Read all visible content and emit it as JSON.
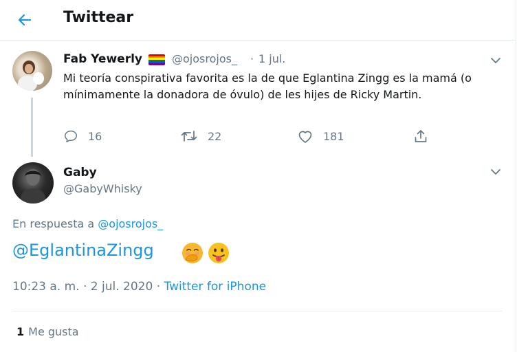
{
  "header": {
    "title": "Twittear"
  },
  "parent_tweet": {
    "name": "Fab Yewerly",
    "handle": "@ojosrojos_",
    "separator": "·",
    "date": "1 jul.",
    "text": "Mi teoría conspirativa favorita es la de que Eglantina Zingg es la mamá (o mínimamente la donadora de óvulo) de les hijes de Ricky Martin.",
    "replies": "16",
    "retweets": "22",
    "likes": "181"
  },
  "main_tweet": {
    "name": "Gaby",
    "handle": "@GabyWhisky",
    "reply_prefix": "En respuesta a",
    "reply_handle": "@ojosrojos_",
    "mention": "@EglantinaZingg",
    "emojis": [
      "face-with-hand-over-mouth",
      "face-with-tongue"
    ],
    "time_date": "10:23 a. m. · 2 jul. 2020 ·",
    "source": "Twitter for iPhone",
    "like_count": "1",
    "like_label": "Me gusta"
  },
  "colors": {
    "accent": "#1b95e0",
    "secondary_text": "#657786",
    "border": "#e6ecf0",
    "thread_line": "#ccd6dd",
    "flag": [
      "#e40303",
      "#ff8c00",
      "#ffed00",
      "#008026",
      "#004dff",
      "#750787"
    ]
  }
}
